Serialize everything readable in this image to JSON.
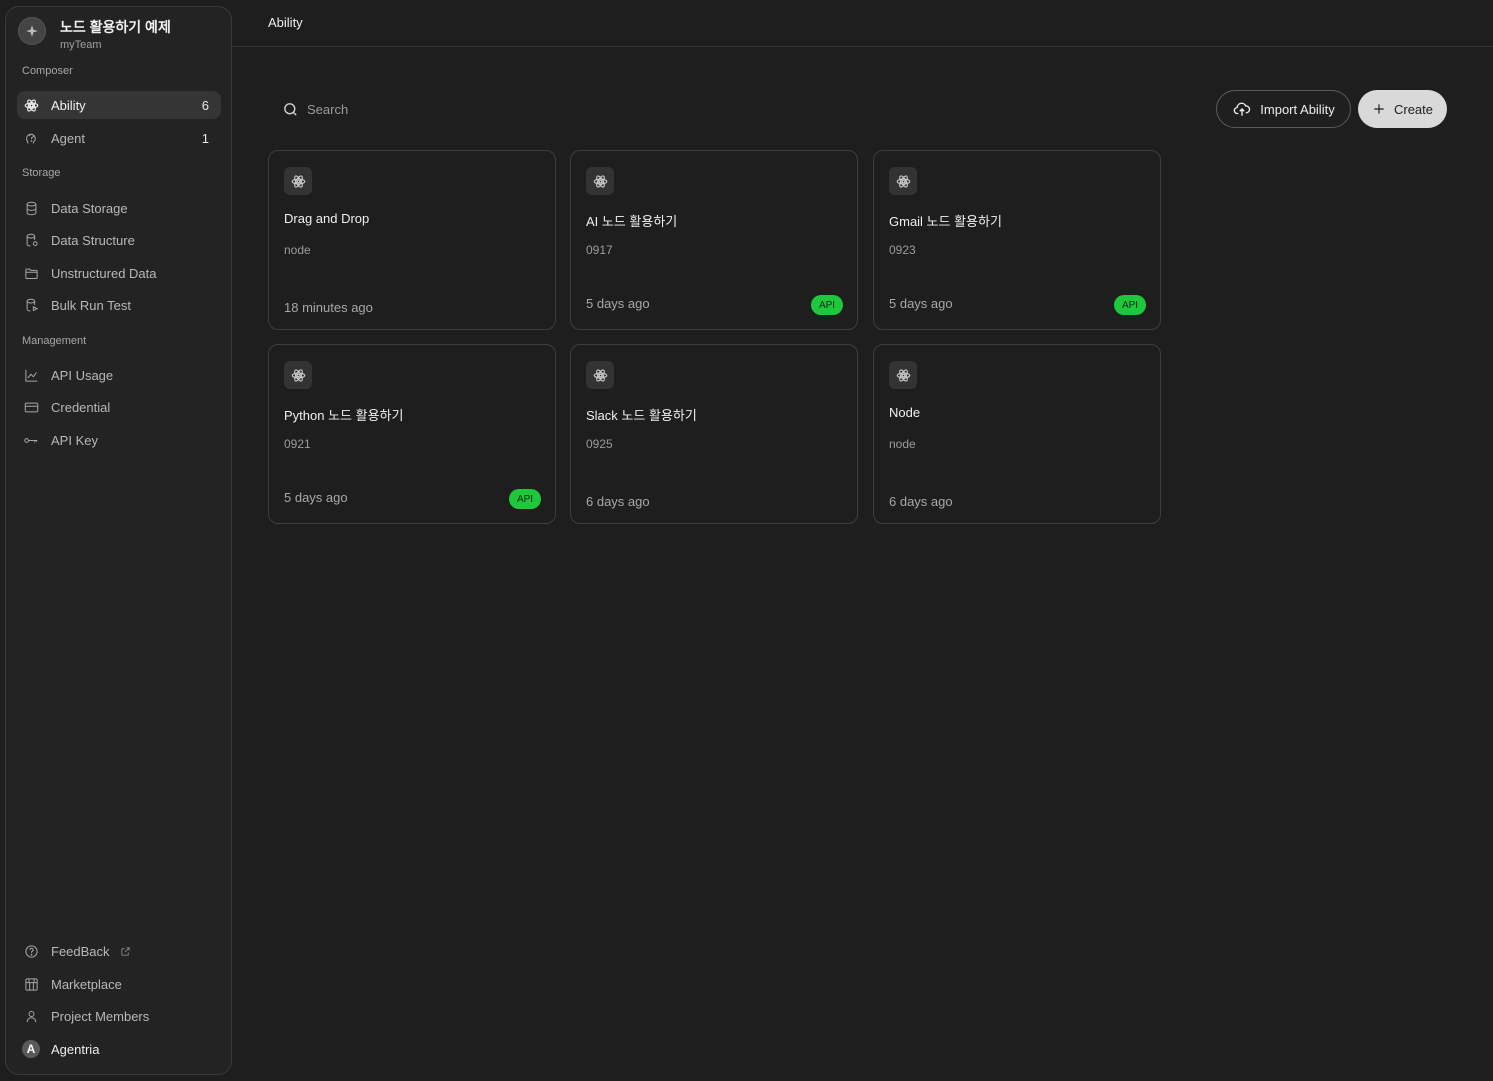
{
  "project": {
    "name": "노드 활용하기 예제",
    "team": "myTeam"
  },
  "sidebar": {
    "composer_label": "Composer",
    "composer_items": [
      {
        "label": "Ability",
        "count": "6",
        "icon": "ability-icon",
        "active": true
      },
      {
        "label": "Agent",
        "count": "1",
        "icon": "agent-head-icon",
        "active": false
      }
    ],
    "storage_label": "Storage",
    "storage_items": [
      {
        "label": "Data Storage",
        "icon": "database-icon"
      },
      {
        "label": "Data Structure",
        "icon": "database-settings-icon"
      },
      {
        "label": "Unstructured Data",
        "icon": "folder-icon"
      },
      {
        "label": "Bulk Run Test",
        "icon": "database-run-icon"
      }
    ],
    "management_label": "Management",
    "management_items": [
      {
        "label": "API Usage",
        "icon": "chart-line-icon"
      },
      {
        "label": "Credential",
        "icon": "credit-card-icon"
      },
      {
        "label": "API Key",
        "icon": "key-icon"
      }
    ],
    "footer_items": [
      {
        "label": "FeedBack",
        "icon": "help-circle-icon"
      },
      {
        "label": "Marketplace",
        "icon": "store-icon"
      },
      {
        "label": "Project Members",
        "icon": "user-icon"
      }
    ],
    "user": {
      "initial": "A",
      "name": "Agentria"
    }
  },
  "header": {
    "title": "Ability"
  },
  "toolbar": {
    "search_placeholder": "Search",
    "import_label": "Import Ability",
    "create_label": "Create"
  },
  "cards": [
    {
      "title": "Drag and Drop",
      "sub": "node",
      "time": "18 minutes ago",
      "badge": ""
    },
    {
      "title": "AI 노드 활용하기",
      "sub": "0917",
      "time": "5 days ago",
      "badge": "API"
    },
    {
      "title": "Gmail 노드 활용하기",
      "sub": "0923",
      "time": "5 days ago",
      "badge": "API"
    },
    {
      "title": "Python 노드 활용하기",
      "sub": "0921",
      "time": "5 days ago",
      "badge": "API"
    },
    {
      "title": "Slack 노드 활용하기",
      "sub": "0925",
      "time": "6 days ago",
      "badge": ""
    },
    {
      "title": "Node",
      "sub": "node",
      "time": "6 days ago",
      "badge": ""
    }
  ],
  "colors": {
    "background": "#1e1e1e",
    "sidebar": "#232323",
    "api_badge": "#1ec83c",
    "create_button": "#d9d9d9"
  }
}
